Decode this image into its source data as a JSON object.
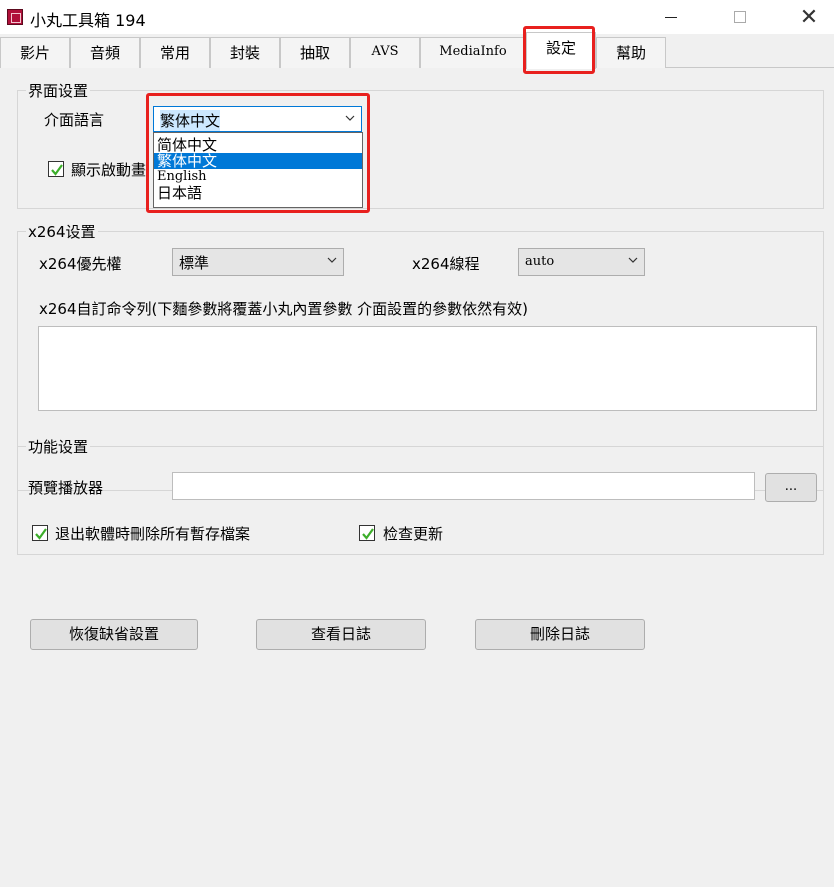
{
  "window": {
    "title": "小丸工具箱 194",
    "minimize_icon": "minimize-icon",
    "maximize_icon": "maximize-icon",
    "close_icon": "close-icon",
    "close_glyph": "✕"
  },
  "tabs": [
    {
      "label": "影片"
    },
    {
      "label": "音頻"
    },
    {
      "label": "常用"
    },
    {
      "label": "封裝"
    },
    {
      "label": "抽取"
    },
    {
      "label": "AVS"
    },
    {
      "label": "MediaInfo"
    },
    {
      "label": "設定",
      "active": true
    },
    {
      "label": "幫助"
    }
  ],
  "ui_group": {
    "title": "界面设置",
    "language_label": "介面語言",
    "language_value": "繁体中文",
    "language_options": [
      "简体中文",
      "繁体中文",
      "English",
      "日本語"
    ],
    "language_selected_index": 1,
    "splash_label": "顯示啟動畫",
    "splash_checked": true
  },
  "x264_group": {
    "title": "x264设置",
    "priority_label": "x264優先權",
    "priority_value": "標準",
    "threads_label": "x264線程",
    "threads_value": "auto",
    "custom_cmd_label": "x264自訂命令列(下麵參數將覆蓋小丸內置參數 介面設置的參數依然有效)",
    "custom_cmd_value": ""
  },
  "func_group": {
    "title": "功能设置",
    "player_label": "預覽播放器",
    "player_value": "",
    "browse_label": "...",
    "delete_temp_label": "退出軟體時刪除所有暫存檔案",
    "delete_temp_checked": true,
    "check_update_label": "检查更新",
    "check_update_checked": true
  },
  "buttons": {
    "restore_defaults": "恢復缺省設置",
    "view_log": "查看日誌",
    "delete_log": "刪除日誌"
  },
  "colors": {
    "highlight": "#e8201e",
    "selection": "#0078d7",
    "check": "#3cae2a"
  }
}
